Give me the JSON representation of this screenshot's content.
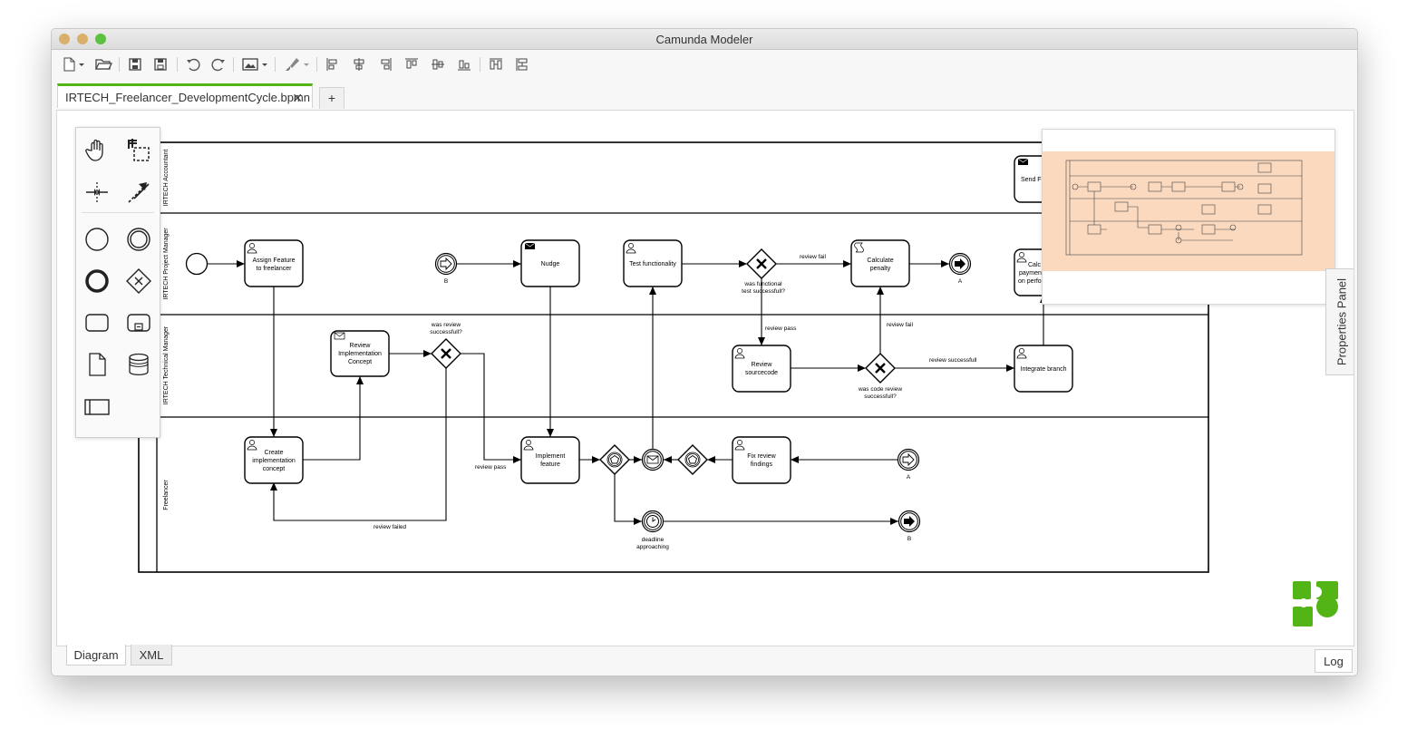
{
  "window": {
    "title": "Camunda Modeler"
  },
  "tabs": {
    "active": "IRTECH_Freelancer_DevelopmentCycle.bpmn",
    "close": "✕",
    "add": "+"
  },
  "bottom": {
    "diagram": "Diagram",
    "xml": "XML",
    "log": "Log"
  },
  "panel": {
    "properties": "Properties Panel"
  },
  "lanes": {
    "accountant": "IRTECH Accountant",
    "project_manager": "IRTECH Project Manager",
    "technical_manager": "IRTECH Technical Manager",
    "freelancer": "Freelancer"
  },
  "tasks": {
    "assign_feature": [
      "Assign Feature",
      "to freelancer"
    ],
    "nudge": "Nudge",
    "test_functionality": "Test functionality",
    "calculate_penalty": [
      "Calculate",
      "penalty"
    ],
    "send_partial": "Send F",
    "calculate_payment": [
      "Calc",
      "paymen",
      "on perfo"
    ],
    "review_impl_concept": [
      "Review",
      "Implementation",
      "Concept"
    ],
    "review_sourcecode": [
      "Review",
      "sourcecode"
    ],
    "integrate_branch": "Integrate branch",
    "create_impl_concept": [
      "Create",
      "implementation",
      "concept"
    ],
    "implement_feature": [
      "Implement",
      "feature"
    ],
    "fix_review": [
      "Fix review",
      "findings"
    ]
  },
  "gateways": {
    "functional_test": [
      "was functional",
      "test successfull?"
    ],
    "review_successful": [
      "was review",
      "successfull?"
    ],
    "code_review": [
      "was code review",
      "successfull?"
    ]
  },
  "events": {
    "link_b_catch": "B",
    "link_a_throw": "A",
    "link_a_catch": "A",
    "link_b_throw": "B",
    "deadline": [
      "deadline",
      "approaching"
    ]
  },
  "flows": {
    "review_fail_1": "review fail",
    "review_pass_1": "review pass",
    "review_fail_2": "review fail",
    "review_successful": "review successfull",
    "review_pass_2": "review pass",
    "review_failed": "review failed"
  }
}
